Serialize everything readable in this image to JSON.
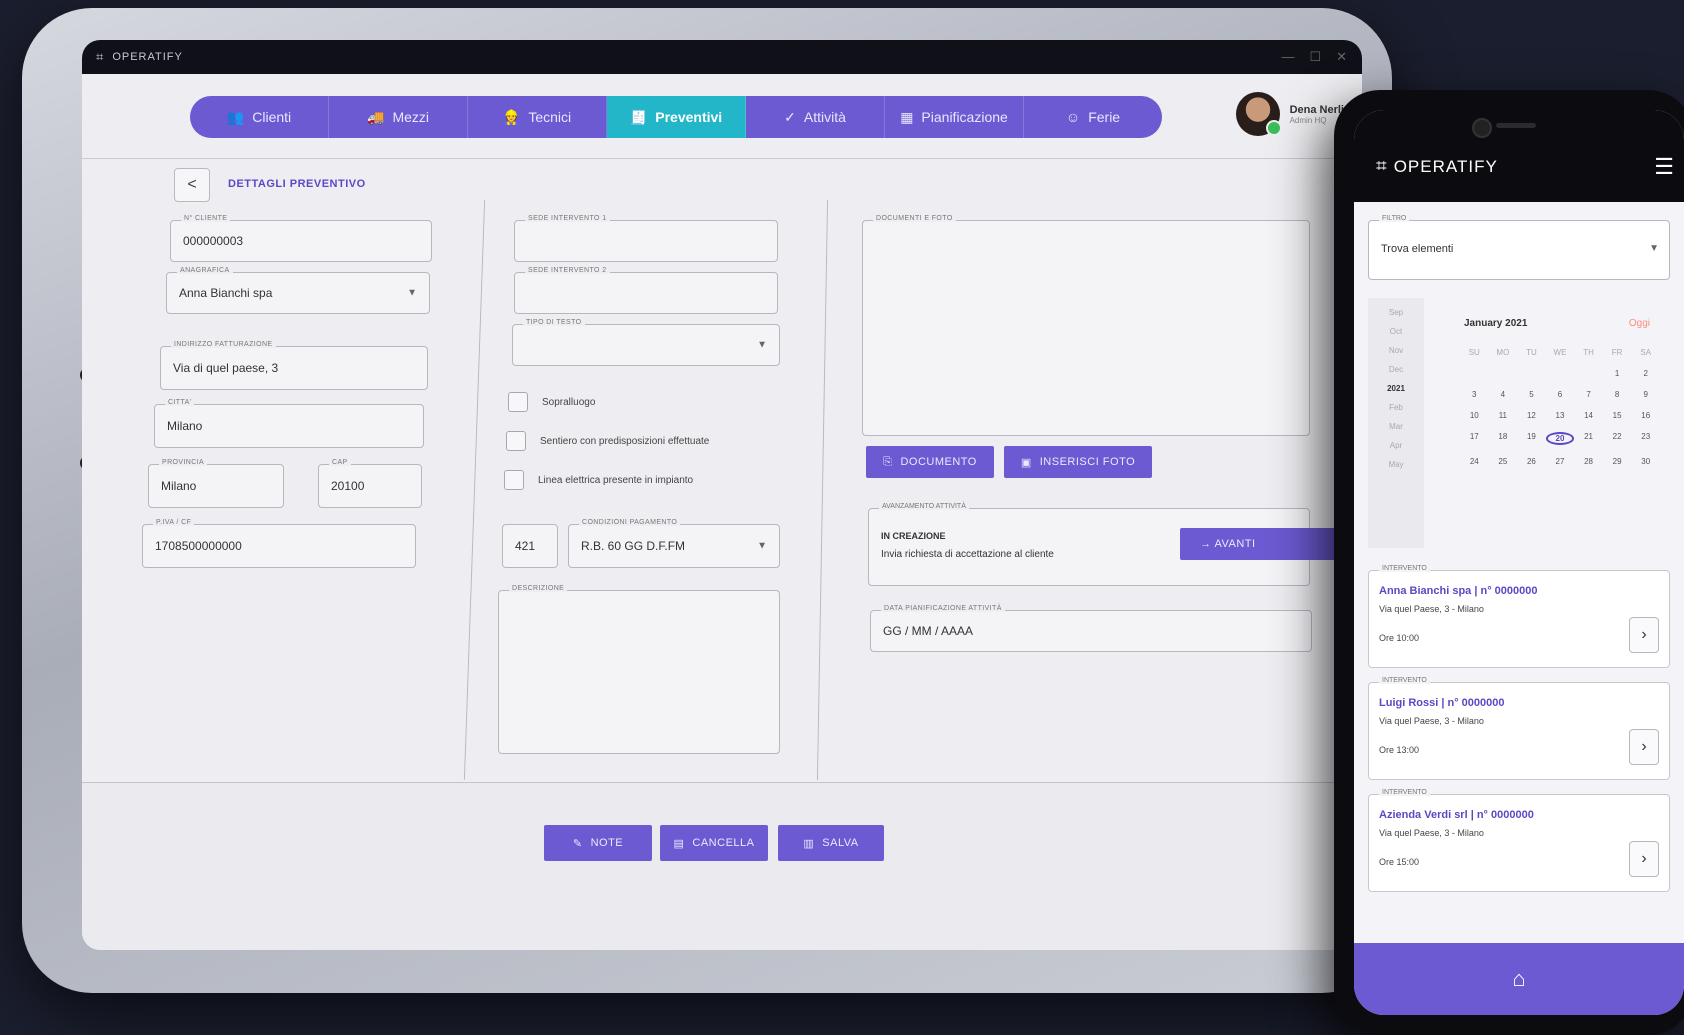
{
  "app": {
    "title": "OPERATIFY",
    "window_controls": [
      "—",
      "☐",
      "✕"
    ]
  },
  "nav": {
    "items": [
      {
        "label": "Clienti",
        "icon": "users-icon",
        "glyph": "👥",
        "active": false
      },
      {
        "label": "Mezzi",
        "icon": "truck-icon",
        "glyph": "🚚",
        "active": false
      },
      {
        "label": "Tecnici",
        "icon": "technician-icon",
        "glyph": "👷",
        "active": false
      },
      {
        "label": "Preventivi",
        "icon": "quote-icon",
        "glyph": "🧾",
        "active": true
      },
      {
        "label": "Attività",
        "icon": "check-icon",
        "glyph": "✓",
        "active": false
      },
      {
        "label": "Pianificazione",
        "icon": "calendar-icon",
        "glyph": "▦",
        "active": false
      },
      {
        "label": "Ferie",
        "icon": "holiday-icon",
        "glyph": "☺",
        "active": false
      }
    ]
  },
  "user": {
    "name": "Dena Nerli",
    "role": "Admin HQ"
  },
  "page": {
    "title": "DETTAGLI PREVENTIVO",
    "back_glyph": "<"
  },
  "form": {
    "n_cliente": {
      "label": "N° CLIENTE",
      "value": "000000003"
    },
    "anagrafica": {
      "label": "ANAGRAFICA",
      "value": "Anna Bianchi spa"
    },
    "indirizzo": {
      "label": "INDIRIZZO FATTURAZIONE",
      "value": "Via di quel paese, 3"
    },
    "citta": {
      "label": "CITTA'",
      "value": "Milano"
    },
    "provincia": {
      "label": "PROVINCIA",
      "value": "Milano"
    },
    "cap": {
      "label": "CAP",
      "value": "20100"
    },
    "piva": {
      "label": "P.IVA / CF",
      "value": "1708500000000"
    },
    "sede1": {
      "label": "SEDE INTERVENTO 1",
      "value": ""
    },
    "sede2": {
      "label": "SEDE INTERVENTO 2",
      "value": ""
    },
    "tipo": {
      "label": "TIPO DI TESTO",
      "value": ""
    },
    "checkboxes": [
      {
        "label": "Sopralluogo"
      },
      {
        "label": "Sentiero con predisposizioni effettuate"
      },
      {
        "label": "Linea elettrica presente in impianto"
      }
    ],
    "codice": {
      "value": "421"
    },
    "pagamento": {
      "label": "CONDIZIONI PAGAMENTO",
      "value": "R.B. 60 GG D.F.FM"
    },
    "descrizione": {
      "label": "DESCRIZIONE",
      "value": ""
    },
    "documenti": {
      "label": "DOCUMENTI E FOTO"
    },
    "btn_documento": "DOCUMENTO",
    "btn_foto": "INSERISCI FOTO",
    "stato": {
      "label": "AVANZAMENTO ATTIVITÀ",
      "status": "IN CREAZIONE",
      "desc": "Invia richiesta di accettazione al cliente",
      "btn": "→ AVANTI"
    },
    "data": {
      "label": "DATA PIANIFICAZIONE ATTIVITÀ",
      "placeholder": "GG / MM / AAAA"
    }
  },
  "actions": {
    "note": "NOTE",
    "cancella": "CANCELLA",
    "salva": "SALVA"
  },
  "phone": {
    "title": "OPERATIFY",
    "filter": {
      "label": "FILTRO",
      "value": "Trova elementi"
    },
    "calendar": {
      "month": "January 2021",
      "today": "Oggi",
      "sub": "JANUARY 2021",
      "side": [
        "Sep",
        "Oct",
        "Nov",
        "Dec",
        "2021",
        "Feb",
        "Mar",
        "Apr",
        "May"
      ],
      "weekdays": [
        "SU",
        "MO",
        "TU",
        "WE",
        "TH",
        "FR",
        "SA"
      ],
      "days": [
        "",
        "",
        "",
        "",
        "",
        "1",
        "2",
        "3",
        "4",
        "5",
        "6",
        "7",
        "8",
        "9",
        "10",
        "11",
        "12",
        "13",
        "14",
        "15",
        "16",
        "17",
        "18",
        "19",
        "20",
        "21",
        "22",
        "23",
        "24",
        "25",
        "26",
        "27",
        "28",
        "29",
        "30"
      ],
      "selected": "20"
    },
    "cards": [
      {
        "label": "INTERVENTO",
        "title": "Anna Bianchi spa | n° 0000000",
        "address": "Via quel Paese, 3 - Milano",
        "time": "Ore 10:00"
      },
      {
        "label": "INTERVENTO",
        "title": "Luigi Rossi | n° 0000000",
        "address": "Via quel Paese, 3 - Milano",
        "time": "Ore 13:00"
      },
      {
        "label": "INTERVENTO",
        "title": "Azienda Verdi srl | n° 0000000",
        "address": "Via quel Paese, 3 - Milano",
        "time": "Ore 15:00"
      }
    ]
  }
}
